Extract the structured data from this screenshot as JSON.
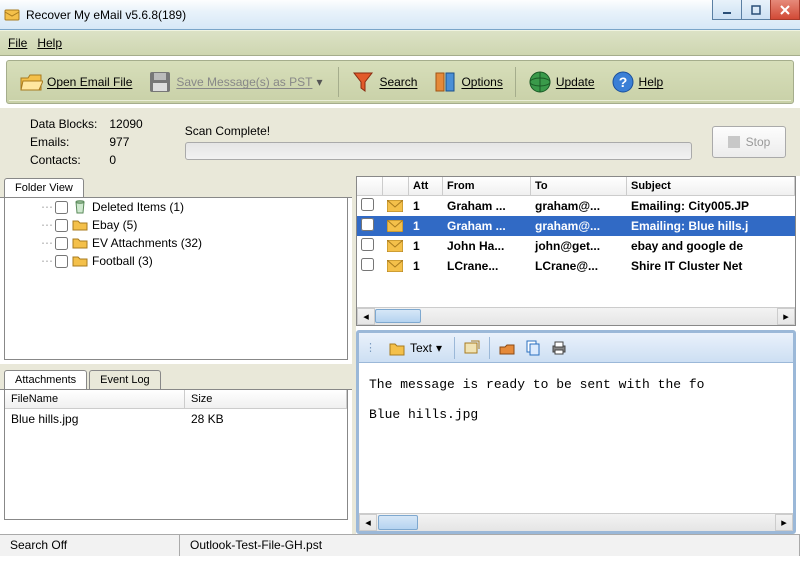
{
  "window": {
    "title": "Recover My eMail v5.6.8(189)"
  },
  "menu": {
    "file": "File",
    "help": "Help"
  },
  "toolbar": {
    "open": "Open Email File",
    "save": "Save Message(s) as PST",
    "search": "Search",
    "options": "Options",
    "update": "Update",
    "help": "Help"
  },
  "stats": {
    "datablocks_label": "Data Blocks:",
    "datablocks": "12090",
    "emails_label": "Emails:",
    "emails": "977",
    "contacts_label": "Contacts:",
    "contacts": "0"
  },
  "scan": {
    "status": "Scan Complete!",
    "stop": "Stop"
  },
  "folder_tab": "Folder View",
  "folders": [
    {
      "label": "Deleted Items (1)",
      "icon": "trash"
    },
    {
      "label": "Ebay (5)",
      "icon": "folder"
    },
    {
      "label": "EV Attachments (32)",
      "icon": "folder"
    },
    {
      "label": "Football (3)",
      "icon": "folder"
    }
  ],
  "attach_tabs": {
    "attachments": "Attachments",
    "eventlog": "Event Log"
  },
  "attach_cols": {
    "filename": "FileName",
    "size": "Size"
  },
  "attachments": [
    {
      "filename": "Blue hills.jpg",
      "size": "28 KB"
    }
  ],
  "email_cols": {
    "att": "Att",
    "from": "From",
    "to": "To",
    "subject": "Subject"
  },
  "emails": [
    {
      "att": "1",
      "from": "Graham ...",
      "to": "graham@...",
      "subject": "Emailing: City005.JP",
      "selected": false
    },
    {
      "att": "1",
      "from": "Graham ...",
      "to": "graham@...",
      "subject": "Emailing: Blue hills.j",
      "selected": true
    },
    {
      "att": "1",
      "from": "John Ha...",
      "to": "john@get...",
      "subject": "ebay and google de",
      "selected": false
    },
    {
      "att": "1",
      "from": "LCrane...",
      "to": "LCrane@...",
      "subject": "Shire IT Cluster Net",
      "selected": false
    }
  ],
  "preview_toolbar": {
    "text": "Text"
  },
  "preview_body": "The message is ready to be sent with the fo\n\nBlue hills.jpg",
  "statusbar": {
    "search": "Search Off",
    "file": "Outlook-Test-File-GH.pst"
  }
}
